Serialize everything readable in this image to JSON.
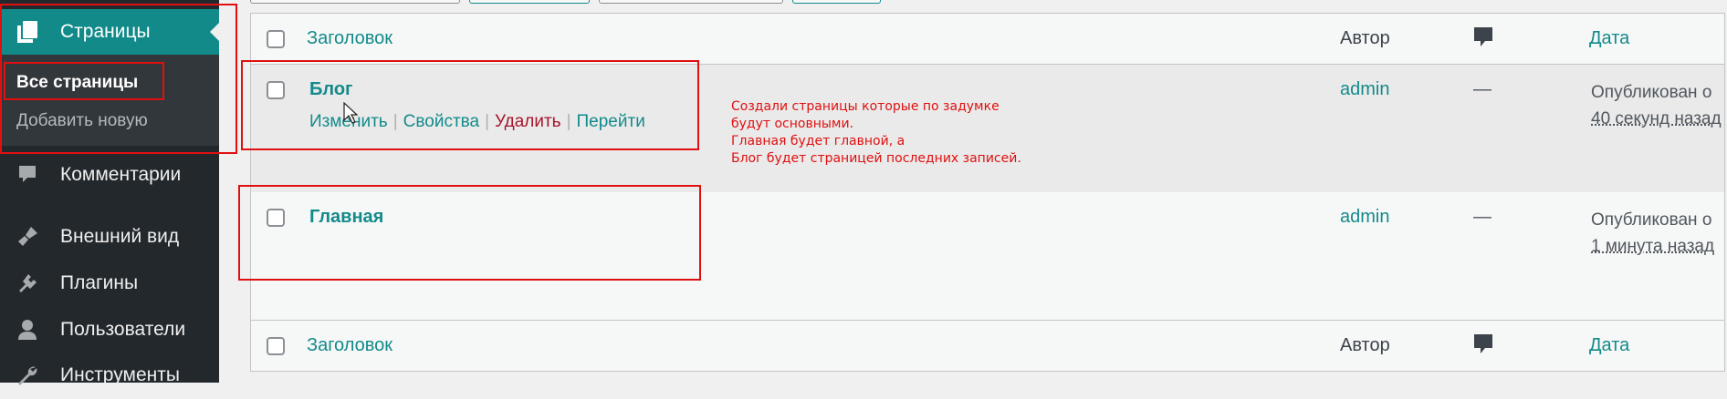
{
  "sidebar": {
    "pages": {
      "label": "Страницы",
      "icon": "pages-icon"
    },
    "submenu": {
      "all_pages": "Все страницы",
      "add_new": "Добавить новую"
    },
    "items": [
      {
        "label": "Комментарии",
        "icon": "comments-icon"
      },
      {
        "label": "Внешний вид",
        "icon": "appearance-icon"
      },
      {
        "label": "Плагины",
        "icon": "plugins-icon"
      },
      {
        "label": "Пользователи",
        "icon": "users-icon"
      },
      {
        "label": "Инструменты",
        "icon": "tools-icon"
      }
    ]
  },
  "table": {
    "columns": {
      "title": "Заголовок",
      "author": "Автор",
      "comments_icon": "comment-bubble-icon",
      "date": "Дата"
    },
    "rows": [
      {
        "title": "Блог",
        "actions": {
          "edit": "Изменить",
          "quick_edit": "Свойства",
          "trash": "Удалить",
          "view": "Перейти"
        },
        "author": "admin",
        "comments": "—",
        "date_status": "Опубликован о",
        "date_ago": "40 секунд назад"
      },
      {
        "title": "Главная",
        "author": "admin",
        "comments": "—",
        "date_status": "Опубликован о",
        "date_ago": "1 минута назад"
      }
    ]
  },
  "annotation": {
    "lines": [
      "Создали страницы которые по задумке",
      "будут основными.",
      "Главная будет главной, а",
      "Блог будет страницей последних записей."
    ],
    "color": "#e01010"
  },
  "colors": {
    "accent": "#138a8a",
    "sidebar": "#23282d",
    "submenu": "#32373c",
    "danger": "#a5152b"
  }
}
